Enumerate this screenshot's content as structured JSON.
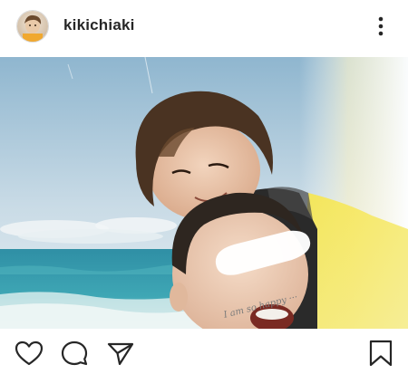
{
  "header": {
    "username": "kikichiaki",
    "avatar_icon": "profile-avatar",
    "more_icon": "more-options-icon"
  },
  "photo": {
    "overlay_text": "I am so happy ···",
    "description_icon": "beach-selfie-photo"
  },
  "actions": {
    "like_icon": "heart-icon",
    "comment_icon": "comment-bubble-icon",
    "share_icon": "paper-plane-icon",
    "save_icon": "bookmark-icon"
  },
  "colors": {
    "text": "#262626",
    "icon": "#262626",
    "divider": "#dbdbdb"
  }
}
